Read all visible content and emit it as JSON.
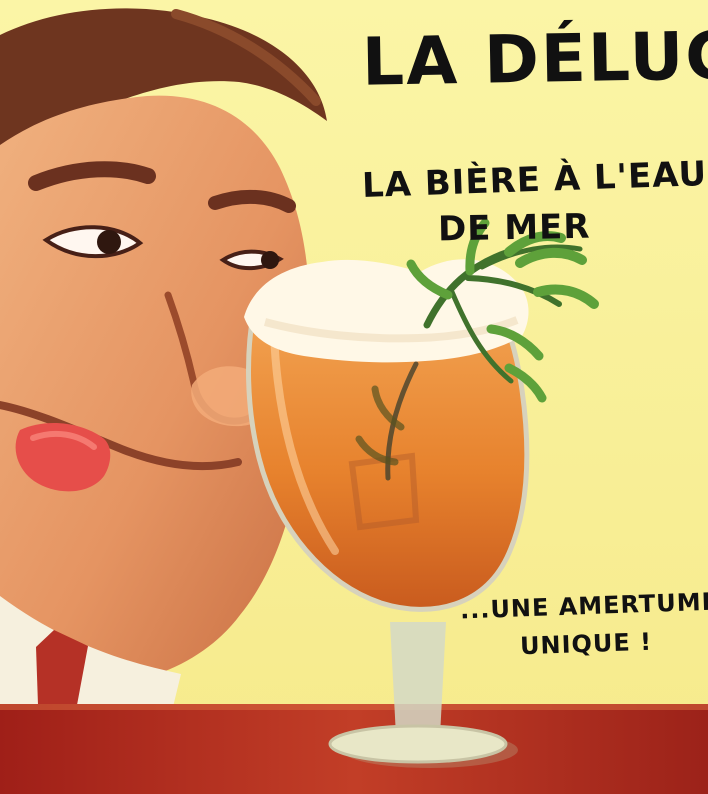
{
  "title": "La Déluge",
  "subtitle": {
    "line1": "La bière à l'eau",
    "line2": "de mer"
  },
  "tagline": {
    "line1": "...une amertume",
    "line2": "unique !"
  },
  "colors": {
    "background": "#f8f09c",
    "hair": "#6d351f",
    "skin": "#e79a68",
    "beer": "#e9842d",
    "foam": "#fff8e1",
    "counter": "#b72f21",
    "herb": "#4d8a31",
    "text": "#111111"
  },
  "icons": {
    "glass": "beer-glass-icon",
    "herb": "seaweed-garnish-icon"
  }
}
